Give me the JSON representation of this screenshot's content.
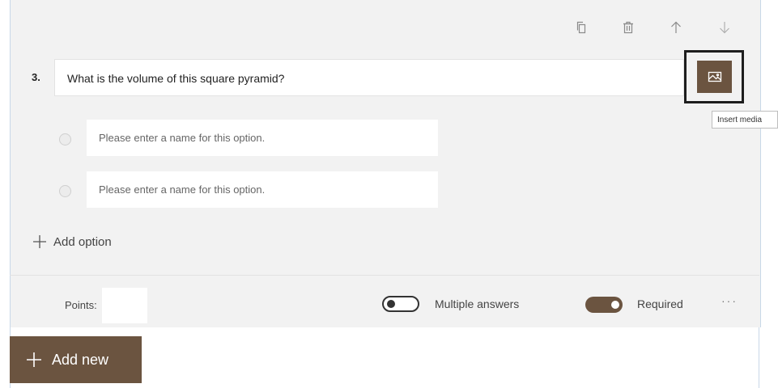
{
  "question": {
    "number": "3.",
    "text": "What is the volume of this square pyramid?"
  },
  "toolbar": {
    "icons": [
      "copy-icon",
      "delete-icon",
      "move-up-icon",
      "move-down-icon"
    ]
  },
  "media": {
    "icon": "image-icon",
    "tooltip": "Insert media"
  },
  "options": [
    {
      "placeholder": "Please enter a name for this option.",
      "value": ""
    },
    {
      "placeholder": "Please enter a name for this option.",
      "value": ""
    }
  ],
  "add_option_label": "Add option",
  "footer": {
    "points_label": "Points:",
    "points_value": "",
    "multiple_answers_label": "Multiple answers",
    "multiple_answers_on": false,
    "required_label": "Required",
    "required_on": true,
    "more_label": "···"
  },
  "add_new_label": "Add new",
  "colors": {
    "accent": "#6b5440",
    "card_background": "#f2f2f2",
    "top_bar": "#6b5d50"
  }
}
